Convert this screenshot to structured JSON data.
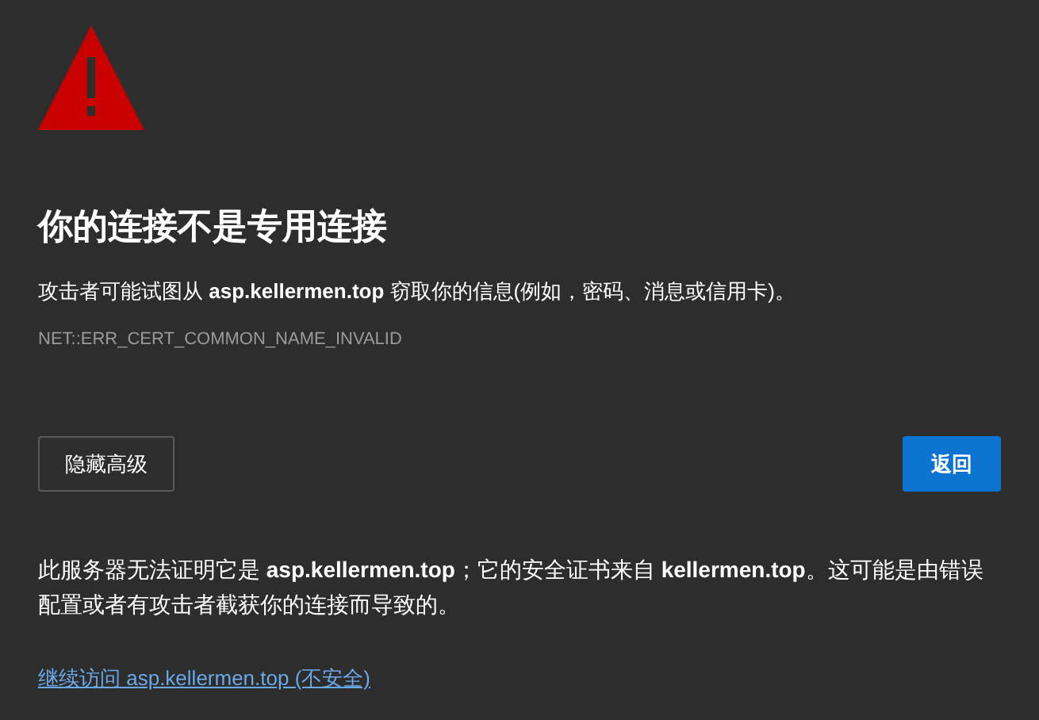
{
  "heading": "你的连接不是专用连接",
  "description": "攻击者可能试图从 **asp.kellermen.top** 窃取你的信息(例如，密码、消息或信用卡)。",
  "error_code": "NET::ERR_CERT_COMMON_NAME_INVALID",
  "buttons": [
    {
      "label": "隐藏高级",
      "kind": "secondary"
    },
    {
      "label": "返回",
      "kind": "primary"
    }
  ],
  "details": "此服务器无法证明它是 **asp.kellermen.top**；它的安全证书来自 **kellermen.top**。这可能是由错误配置或者有攻击者截获你的连接而导致的。",
  "proceed_link": "继续访问 asp.kellermen.top (不安全)"
}
